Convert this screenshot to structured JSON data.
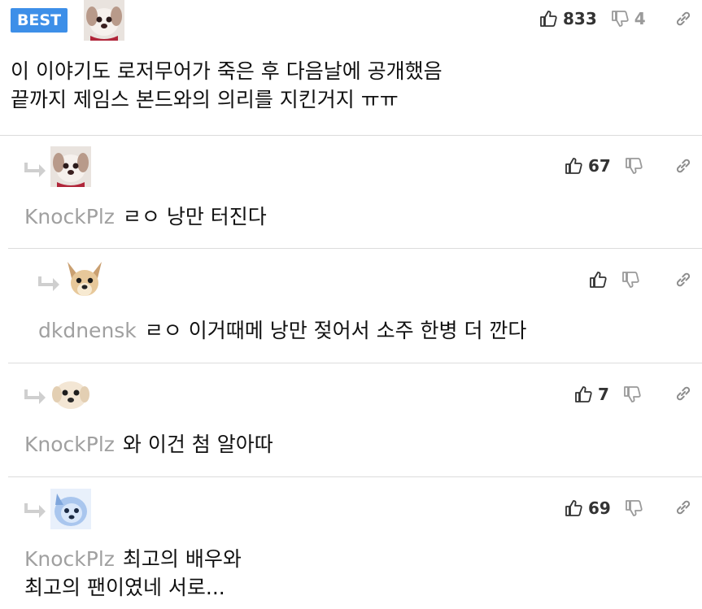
{
  "colors": {
    "best_badge": "#3d8fe8",
    "divider": "#dcdcdc",
    "author": "#a0a0a0",
    "icon": "#8c8c8c"
  },
  "comments": [
    {
      "badge": "BEST",
      "avatar": "puppy-red-collar",
      "up": "833",
      "down": "4",
      "author": "",
      "lines": [
        "이 이야기도 로저무어가 죽은 후 다음날에 공개했음",
        "끝까지 제임스 본드와의 의리를 지킨거지 ㅠㅠ"
      ]
    },
    {
      "avatar": "puppy-red-collar",
      "up": "67",
      "author": "KnockPlz",
      "lines": [
        "ㄹㅇ 낭만 터진다"
      ]
    },
    {
      "avatar": "chihuahua",
      "up": "",
      "author": "dkdnensk",
      "lines": [
        "ㄹㅇ 이거때메 낭만 젖어서 소주 한병 더 깐다"
      ]
    },
    {
      "avatar": "puppy-white",
      "up": "7",
      "author": "KnockPlz",
      "lines": [
        "와 이건 첨 알아따"
      ]
    },
    {
      "avatar": "samoyed-blue",
      "up": "69",
      "author": "KnockPlz",
      "lines": [
        "최고의 배우와",
        "최고의 팬이였네 서로..."
      ]
    }
  ]
}
